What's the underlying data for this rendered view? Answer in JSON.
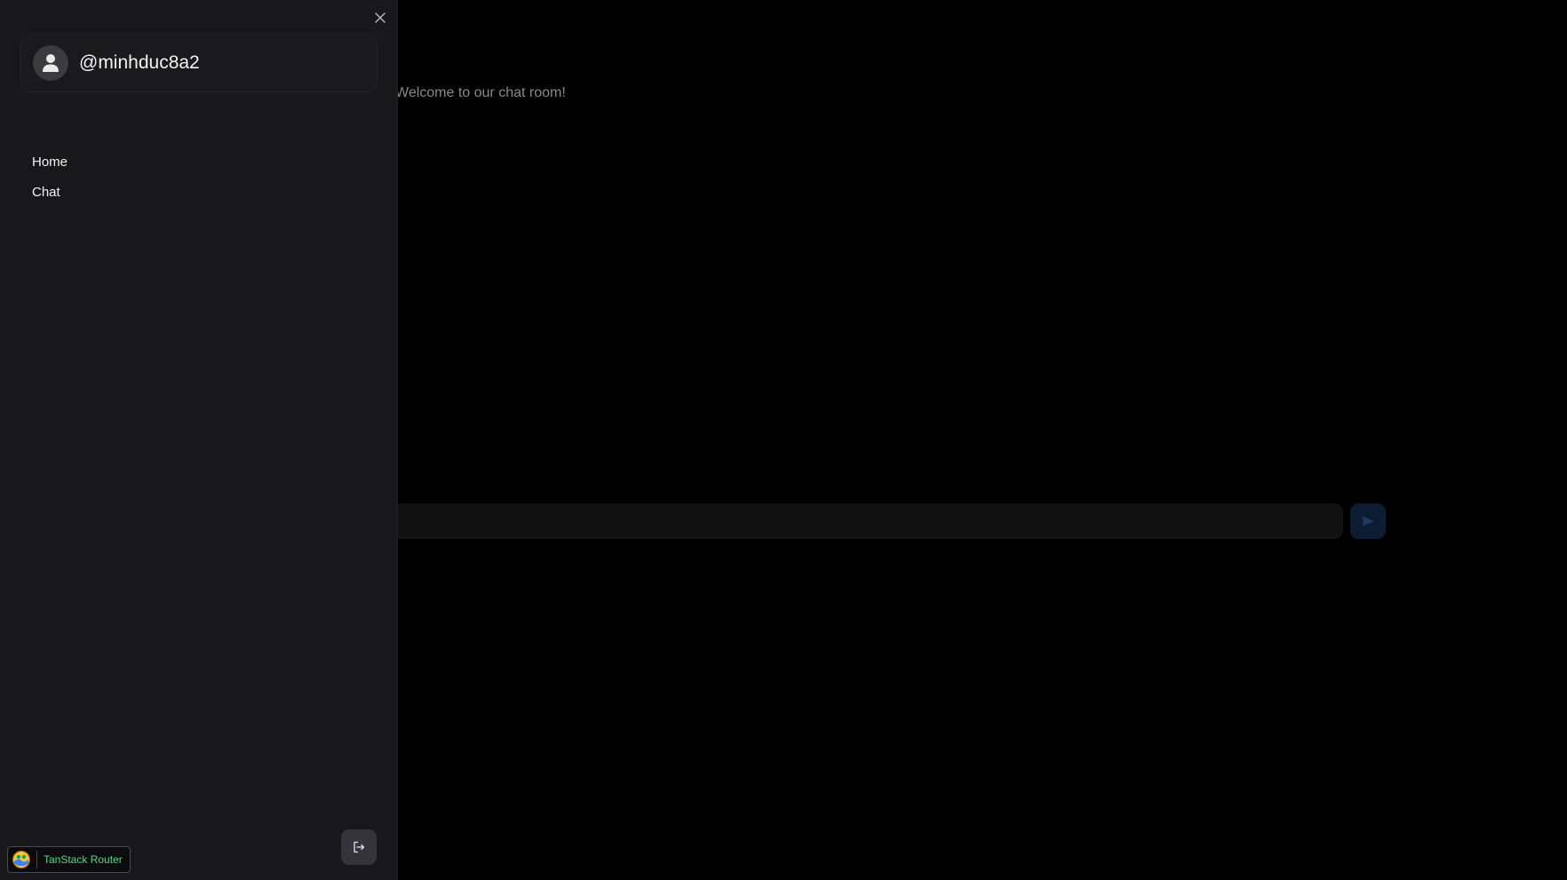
{
  "main": {
    "welcome_text": "Welcome to our chat room!",
    "message_placeholder": "",
    "send_color": "#0b1c33"
  },
  "drawer": {
    "username": "@minhduc8a2",
    "nav": [
      {
        "label": "Home"
      },
      {
        "label": "Chat"
      }
    ]
  },
  "devtools": {
    "label": "TanStack Router",
    "label_color": "#4ade80"
  },
  "icons": {
    "close": "close-icon",
    "avatar": "user-icon",
    "logout": "logout-icon",
    "send": "send-icon"
  }
}
